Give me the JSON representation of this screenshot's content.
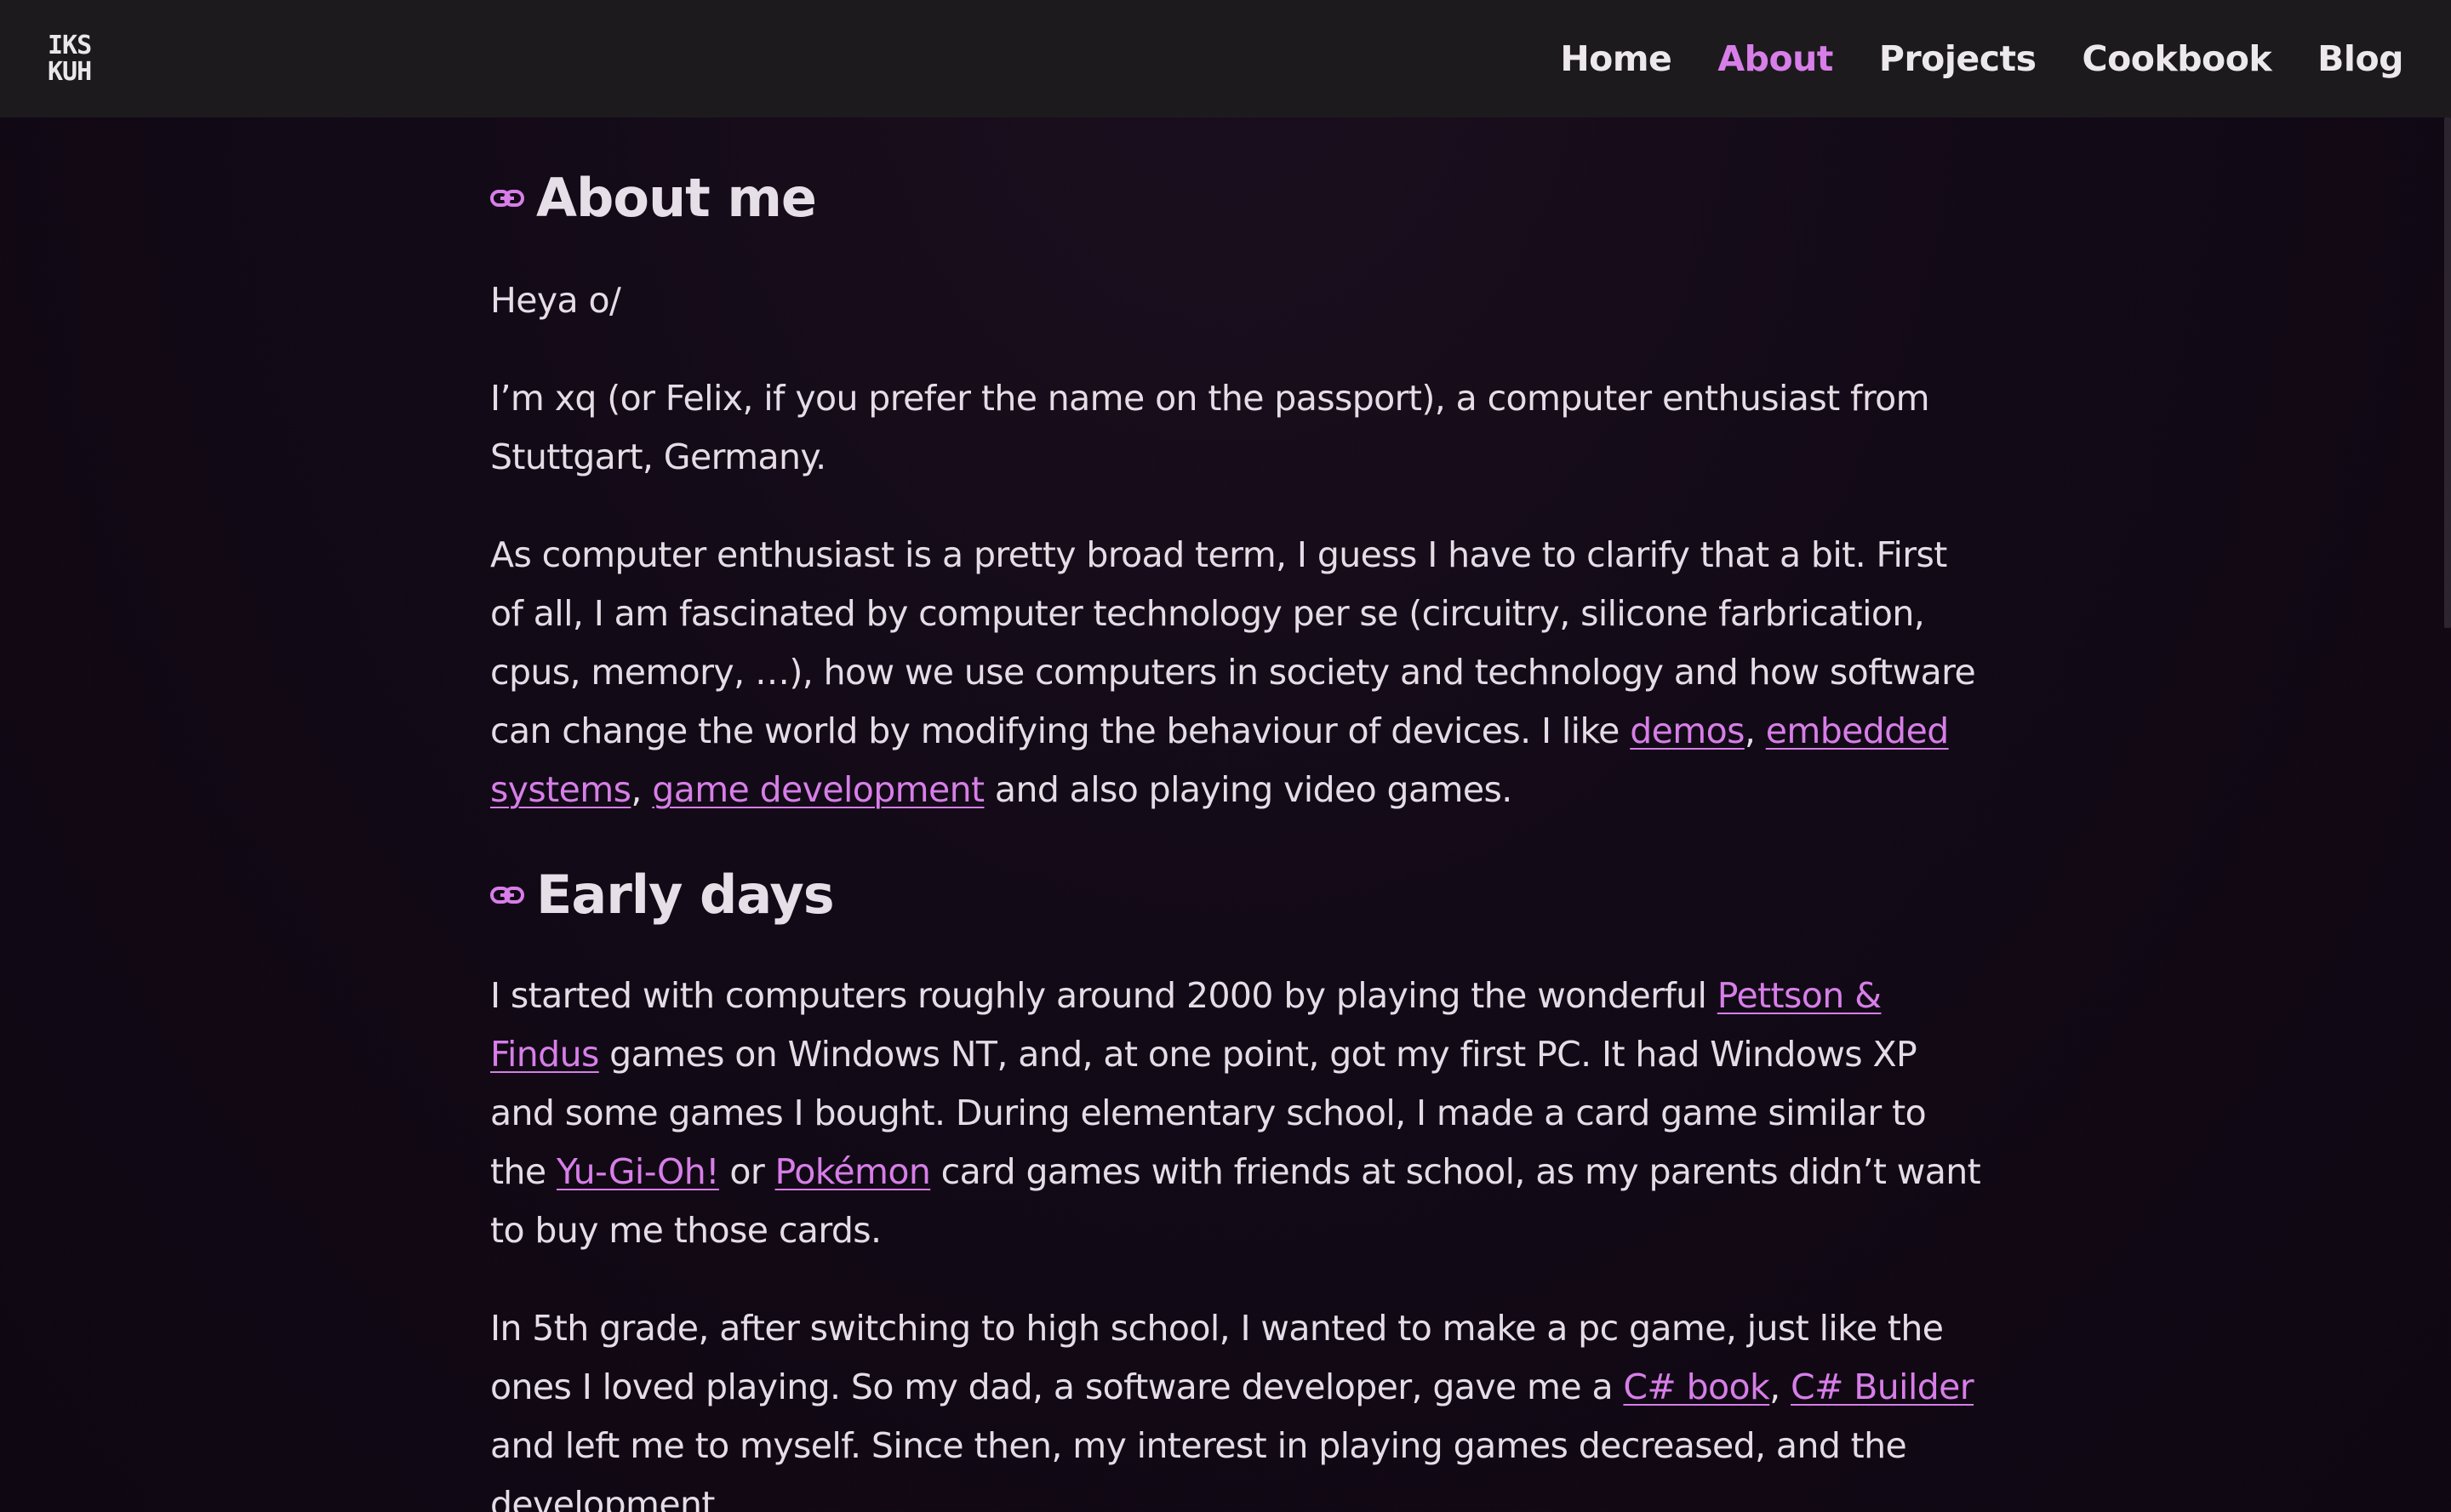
{
  "header": {
    "logo_line1": "IKS",
    "logo_line2": "KUH",
    "nav": {
      "home": "Home",
      "about": "About",
      "projects": "Projects",
      "cookbook": "Cookbook",
      "blog": "Blog"
    },
    "active_item": "About"
  },
  "colors": {
    "accent": "#d77ee8",
    "background": "#130a17",
    "header_bg": "#1d1a1e",
    "text": "#e4dde6"
  },
  "sections": {
    "about": {
      "heading": "About me",
      "heading_icon": "link-icon",
      "heya": "Heya o/",
      "intro": "I’m xq (or Felix, if you prefer the name on the passport), a computer enthusiast from Stuttgart, Germany.",
      "broad_text": "As computer enthusiast is a pretty broad term, I guess I have to clarify that a bit. First of all, I am fascinated by computer technology per se (circuitry, silicone farbrication, cpus, memory, …), how we use computers in society and technology and how software can change the world by modifying the behaviour of devices. I like ",
      "link_demos": "demos",
      "sep1": ", ",
      "link_embedded": "embedded systems",
      "sep2": ", ",
      "link_gamedev": "game development",
      "broad_end": " and also playing video games."
    },
    "early": {
      "heading": "Early days",
      "heading_icon": "link-icon",
      "p1_a": "I started with computers roughly around 2000 by playing the wonderful ",
      "link_pettson": "Pettson & Findus",
      "p1_b": " games on Windows NT, and, at one point, got my first PC. It had Windows XP and some games I bought. During elementary school, I made a card game similar to the ",
      "link_yugioh": "Yu-Gi-Oh!",
      "p1_c": " or ",
      "link_pokemon": "Pokémon",
      "p1_d": " card games with friends at school, as my parents didn’t want to buy me those cards.",
      "p2_a": "In 5th grade, after switching to high school, I wanted to make a pc game, just like the ones I loved playing. So my dad, a software developer, gave me a ",
      "link_csbook": "C# book",
      "p2_sep": ", ",
      "link_csbuilder": "C# Builder",
      "p2_b": " and left me to myself. Since then, my interest in playing games decreased, and the development"
    }
  }
}
